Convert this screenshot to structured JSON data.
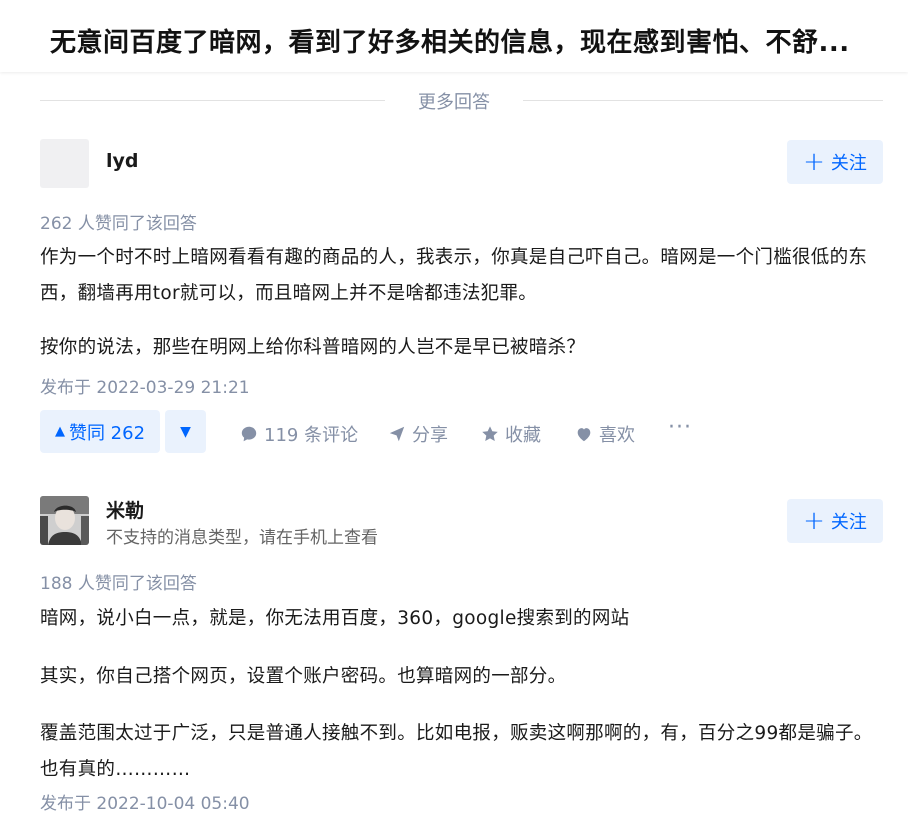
{
  "question": {
    "title": "无意间百度了暗网，看到了好多相关的信息，现在感到害怕、不舒..."
  },
  "divider": {
    "label": "更多回答"
  },
  "answers": [
    {
      "author": "lyd",
      "bio": "",
      "follow_label": "关注",
      "votes_text": "262 人赞同了该回答",
      "paragraphs": [
        "作为一个时不时上暗网看看有趣的商品的人，我表示，你真是自己吓自己。暗网是一个门槛很低的东西，翻墙再用tor就可以，而且暗网上并不是啥都违法犯罪。",
        "按你的说法，那些在明网上给你科普暗网的人岂不是早已被暗杀？"
      ],
      "published": "发布于 2022-03-29 21:21",
      "actions": {
        "upvote": "赞同 262",
        "comments": "119 条评论",
        "share": "分享",
        "collect": "收藏",
        "like": "喜欢",
        "more": "···"
      }
    },
    {
      "author": "米勒",
      "bio": "不支持的消息类型，请在手机上查看",
      "follow_label": "关注",
      "votes_text": "188 人赞同了该回答",
      "paragraphs": [
        "暗网，说小白一点，就是，你无法用百度，360，google搜索到的网站",
        "其实，你自己搭个网页，设置个账户密码。也算暗网的一部分。",
        "覆盖范围太过于广泛，只是普通人接触不到。比如电报，贩卖这啊那啊的，有，百分之99都是骗子。也有真的…………"
      ],
      "published": "发布于 2022-10-04 05:40"
    }
  ],
  "colors": {
    "accent": "#0066ff",
    "accent_bg": "#eaf2fd",
    "muted": "#8590a6"
  }
}
